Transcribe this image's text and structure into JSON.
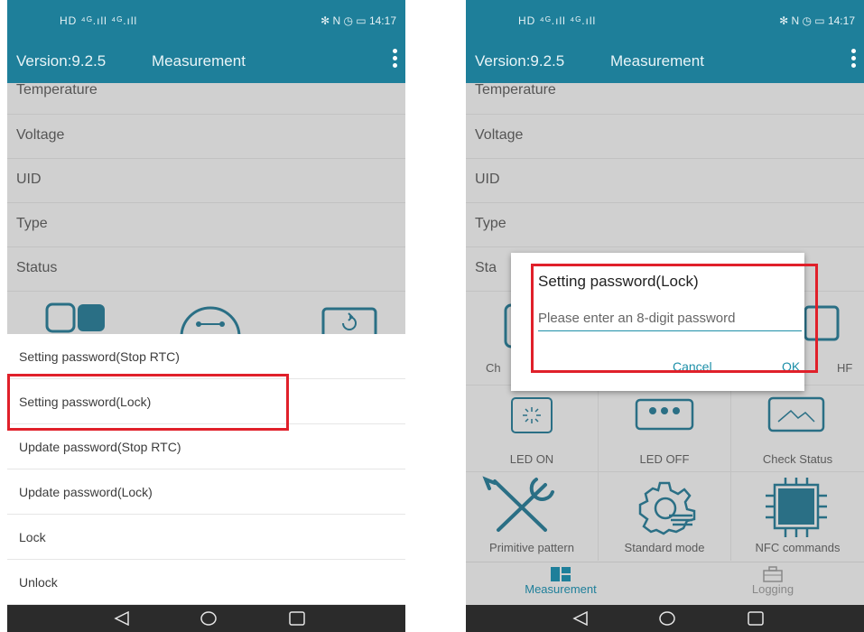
{
  "status_bar": {
    "left": "HD ⁴ᴳ.ıll ⁴ᴳ.ıll",
    "right": "✻ N ◷ ▭ 14:17"
  },
  "app_bar": {
    "version": "Version:9.2.5",
    "title": "Measurement"
  },
  "list_rows": [
    "Temperature",
    "Voltage",
    "UID",
    "Type",
    "Status"
  ],
  "left_screen": {
    "sheet_items": [
      "Setting password(Stop RTC)",
      "Setting password(Lock)",
      "Update password(Stop RTC)",
      "Update password(Lock)",
      "Lock",
      "Unlock"
    ]
  },
  "right_screen": {
    "row_fragments": {
      "status": "Sta",
      "cell_left": "Ch",
      "cell_right": "HF"
    },
    "dialog": {
      "title": "Setting password(Lock)",
      "placeholder": "Please enter an 8-digit password",
      "cancel": "Cancel",
      "ok": "OK"
    },
    "grid_labels": [
      "LED ON",
      "LED OFF",
      "Check Status",
      "Primitive pattern",
      "Standard mode",
      "NFC commands"
    ],
    "bottom_nav": {
      "tab1": "Measurement",
      "tab2": "Logging"
    }
  },
  "colors": {
    "app_bar": "#1e7f9a",
    "highlight": "#e0202a",
    "accent": "#1e8fa8",
    "scrim_gray": "#d0d0d0"
  },
  "icons": {
    "nav": [
      "back-triangle-icon",
      "home-circle-icon",
      "recents-square-icon"
    ],
    "grid": [
      "grid-icon",
      "link-icon",
      "refresh-icon",
      "sun-icon",
      "dots-icon",
      "mountain-icon",
      "tools-icon",
      "gear-icon",
      "chip-icon",
      "layout-icon",
      "briefcase-icon"
    ]
  }
}
